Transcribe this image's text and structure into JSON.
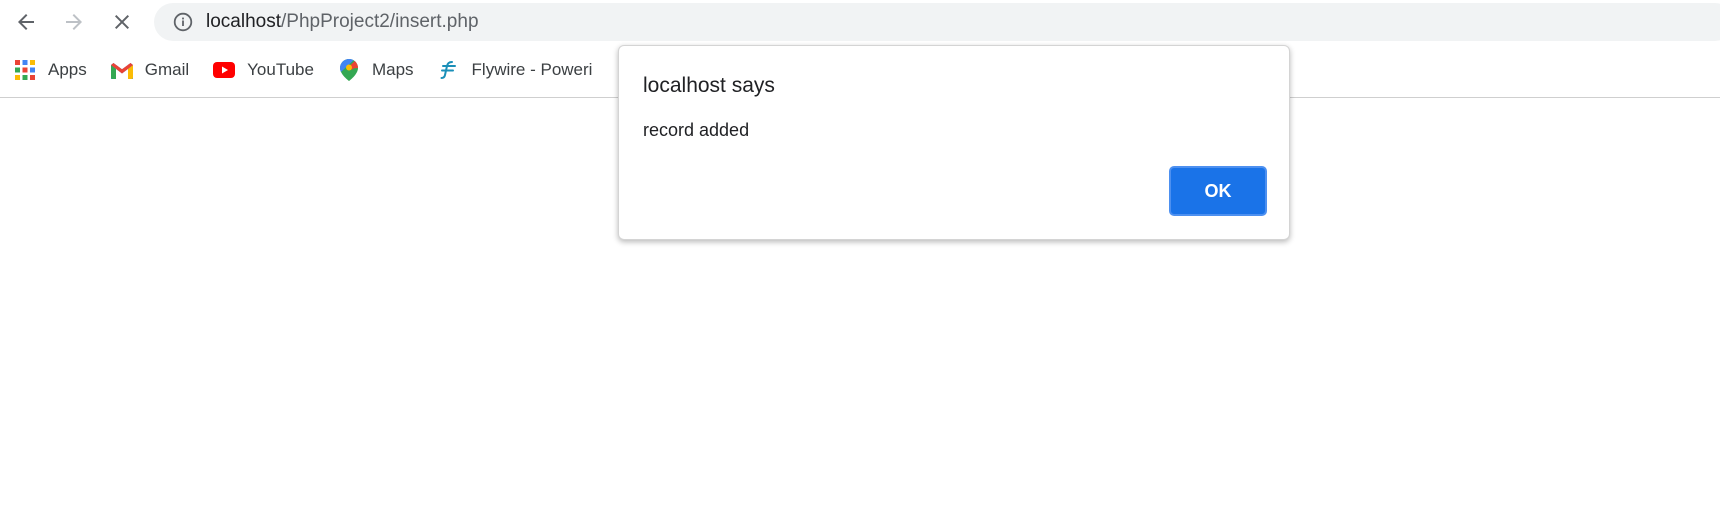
{
  "browser": {
    "url_host": "localhost",
    "url_path": "/PhpProject2/insert.php",
    "icons": {
      "back": "arrow-left-icon",
      "forward": "arrow-right-icon",
      "stop": "close-icon",
      "site_info": "info-icon"
    }
  },
  "bookmarks": [
    {
      "label": "Apps",
      "icon": "apps-grid-icon"
    },
    {
      "label": "Gmail",
      "icon": "gmail-icon"
    },
    {
      "label": "YouTube",
      "icon": "youtube-icon"
    },
    {
      "label": "Maps",
      "icon": "maps-pin-icon"
    },
    {
      "label": "Flywire - Poweri",
      "icon": "flywire-icon"
    }
  ],
  "dialog": {
    "title": "localhost says",
    "message": "record added",
    "ok_label": "OK"
  },
  "colors": {
    "accent": "#1a73e8",
    "omnibox_bg": "#f1f3f4"
  }
}
